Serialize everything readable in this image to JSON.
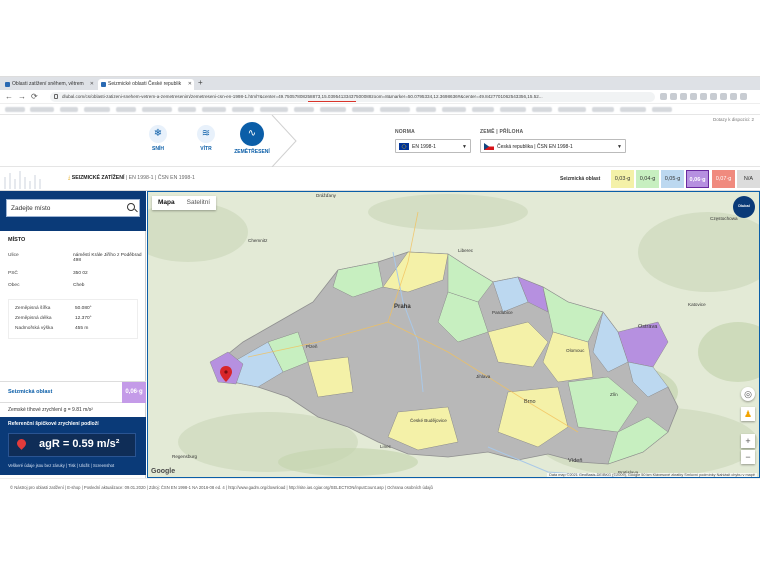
{
  "browser": {
    "tabs": [
      {
        "label": "Oblasti zatížení sněhem, větrem"
      },
      {
        "label": "Seizmické oblasti České republik"
      }
    ],
    "url": "dlubal.com/cs/oblasti-zatizeni-snehem-vetrem-a-zemetresenim/zemetreseni-csn-en-1998-1.html?&center=49.75057808258873,15.03954133437500088zoom=8&marker=50.0795334,12.3698636#&center=49.8427701062543356,15.52..."
  },
  "header": {
    "categories": [
      {
        "label": "SNÍH",
        "icon": "snowflake-icon"
      },
      {
        "label": "VÍTR",
        "icon": "wind-icon"
      },
      {
        "label": "ZEMĚTŘESENÍ",
        "icon": "seismic-wave-icon"
      }
    ],
    "norm_label": "NORMA",
    "norm_value": "EN 1998-1",
    "country_label": "ZEMĚ | PŘÍLOHA",
    "country_value": "Česká republika | ČSN EN 1998-1",
    "right_note": "Dotazy k dispozici: 2"
  },
  "subheader": {
    "crumb_main": "SEIZMICKÉ ZATÍŽENÍ",
    "crumb_norm": "EN 1998-1",
    "crumb_annex": "ČSN EN 1998-1",
    "zone_label": "Seizmická oblast",
    "zones": [
      {
        "label": "0,03·g",
        "color": "#f4f1a8"
      },
      {
        "label": "0,04·g",
        "color": "#c7efc0"
      },
      {
        "label": "0,05·g",
        "color": "#bcd8f0"
      },
      {
        "label": "0,06·g",
        "color": "#b690e0"
      },
      {
        "label": "0,07·g",
        "color": "#f08a7e"
      },
      {
        "label": "N/A",
        "color": "#dcdcdc"
      }
    ]
  },
  "sidebar": {
    "search_placeholder": "Zadejte místo",
    "section_title": "MÍSTO",
    "street_label": "Ulice",
    "street_value": "náměstí Krále Jiřího z Poděbrad 498",
    "zip_label": "PSČ",
    "zip_value": "350 02",
    "city_label": "Obec",
    "city_value": "Cheb",
    "lat_label": "Zeměpisná šířka",
    "lat_value": "50.080°",
    "lon_label": "Zeměpisná délka",
    "lon_value": "12.370°",
    "alt_label": "Nadmořská výška",
    "alt_value": "455 m",
    "seismic_label": "Seizmická oblast",
    "seismic_value": "0,06·g",
    "gravity_text": "Zemské tíhové zrychlení g = 9.81 m/s²",
    "accel_title": "Referenční špičkové zrychlení podloží",
    "accel_value": "agR = 0.59 m/s²",
    "accel_links": "Veškeré údaje jsou bez záruky | Tisk | Uložit | Screenshot"
  },
  "map": {
    "tab_map": "Mapa",
    "tab_sat": "Satelitní",
    "google": "Google",
    "footer": "Data map ©2021 GeoBasis-DE/BKG (©2009), Google  50 km  Klávesové zkratky  Smluvní podmínky  Nahlásit chybu v mapě",
    "logo_text": "Dlubal",
    "cities": [
      {
        "name": "Drážďany"
      },
      {
        "name": "Praha"
      },
      {
        "name": "Brno"
      },
      {
        "name": "Ostrava"
      },
      {
        "name": "Katovice"
      },
      {
        "name": "Vídeň"
      },
      {
        "name": "Linec"
      },
      {
        "name": "Plzeň"
      },
      {
        "name": "České Budějovice"
      },
      {
        "name": "Liberec"
      },
      {
        "name": "Olomouc"
      },
      {
        "name": "Pardubice"
      },
      {
        "name": "Jihlava"
      },
      {
        "name": "Zlín"
      },
      {
        "name": "Regensburg"
      },
      {
        "name": "Chemnitz"
      },
      {
        "name": "Częstochowa"
      },
      {
        "name": "Bratislava"
      }
    ]
  },
  "footer": {
    "text": "© Nástroj pro oblasti zatížení  |  E-shop  |  Poslední aktualizace: 09.01.2020  |  Zdroj: ČSN EN 1998-1 NA 2016-08 ed. 4  |  http://www.gadm.org/download  |  http://site.ias.cgiar.org/SELECTION/inputCount.asp  |  Ochrana osobních údajů"
  }
}
